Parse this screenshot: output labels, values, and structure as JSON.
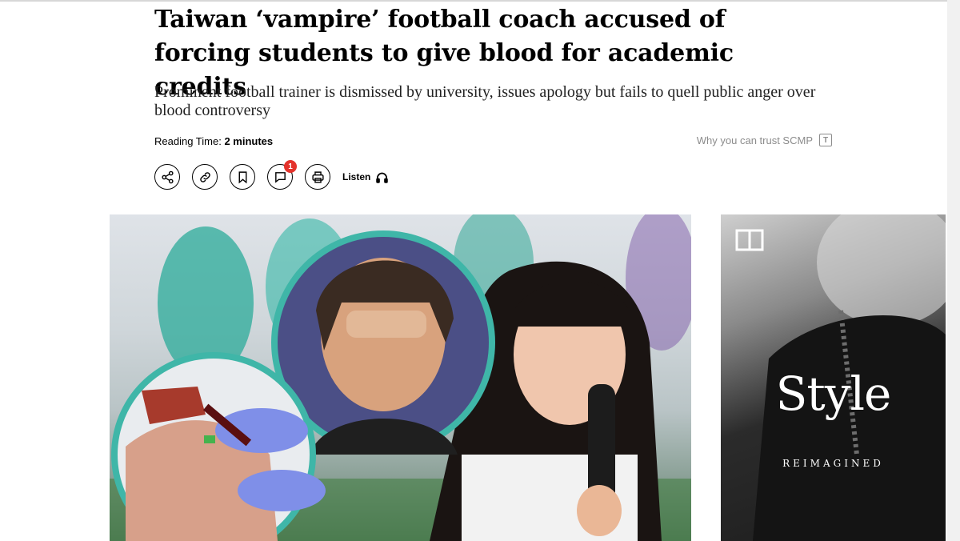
{
  "article": {
    "headline": "Taiwan ‘vampire’ football coach accused of forcing students to give blood for academic credits",
    "subheadline": "Prominent football trainer is dismissed by university, issues apology but fails to quell public anger over blood controversy",
    "reading_time_label": "Reading Time:",
    "reading_time_value": "2 minutes",
    "trust_text": "Why you can trust SCMP"
  },
  "actions": {
    "comment_count": "1",
    "listen_label": "Listen"
  },
  "ad": {
    "title": "Style",
    "subtitle": "REIMAGINED"
  },
  "colors": {
    "badge": "#e4322b",
    "text_muted": "#8c8c8c",
    "accent_teal": "#3fb6a8"
  },
  "icons": [
    "share-icon",
    "link-icon",
    "bookmark-icon",
    "comment-icon",
    "print-icon",
    "headphones-icon",
    "trust-icon",
    "style-logo-icon"
  ]
}
